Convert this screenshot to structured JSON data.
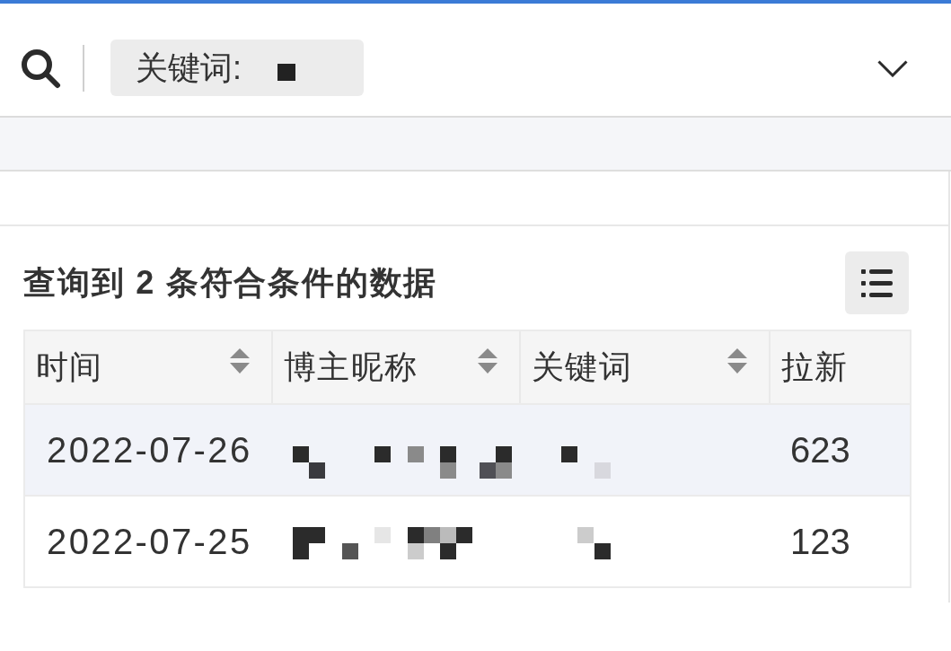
{
  "search_bar": {
    "field": {
      "label": "关键词:"
    }
  },
  "results": {
    "summary": "查询到 2 条符合条件的数据",
    "table": {
      "columns": [
        {
          "label": "时间",
          "sortable": true
        },
        {
          "label": "博主昵称",
          "sortable": true
        },
        {
          "label": "关键词",
          "sortable": true
        },
        {
          "label": "拉新",
          "sortable": false
        }
      ],
      "rows": [
        {
          "time": "2022-07-26",
          "new_users": "623",
          "highlighted": true
        },
        {
          "time": "2022-07-25",
          "new_users": "123",
          "highlighted": false
        }
      ]
    }
  }
}
